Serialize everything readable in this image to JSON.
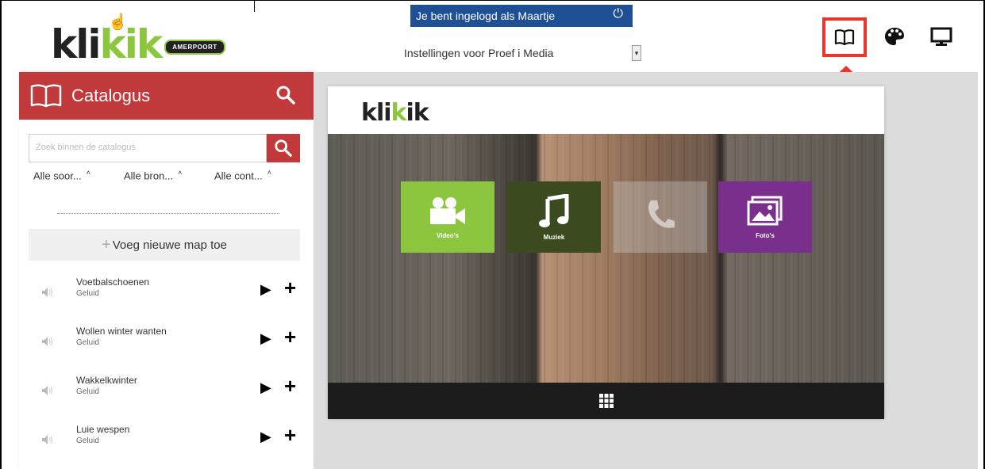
{
  "header": {
    "logo_text_dark": "kli",
    "logo_text_green_k": "k",
    "logo_text_tail": "ik",
    "logo_badge": "AMERPOORT",
    "login_banner": "Je bent ingelogd als Maartje",
    "settings_label": "Instellingen voor",
    "settings_value": "Proef i Media",
    "icons": [
      "book-icon",
      "palette-icon",
      "monitor-icon"
    ],
    "highlight_color": "#e8372a"
  },
  "sidebar": {
    "title": "Catalogus",
    "accent_color": "#c1393b",
    "search_placeholder": "Zoek binnen de catalogus",
    "filters": [
      "Alle soor...",
      "Alle bron...",
      "Alle cont..."
    ],
    "add_folder_label": "Voeg nieuwe map toe",
    "items": [
      {
        "name": "Voetbalschoenen",
        "kind": "Geluid"
      },
      {
        "name": "Wollen winter wanten",
        "kind": "Geluid"
      },
      {
        "name": "Wakkelkwinter",
        "kind": "Geluid"
      },
      {
        "name": "Luie wespen",
        "kind": "Geluid"
      }
    ]
  },
  "preview": {
    "logo_dark": "kli",
    "logo_green": "k",
    "logo_tail": "ik",
    "tiles": [
      {
        "label": "Video's",
        "color": "#8cc63f",
        "icon": "video-camera-icon"
      },
      {
        "label": "Muziek",
        "color": "#3b4a1f",
        "icon": "music-note-icon"
      },
      {
        "label": "",
        "color": "#c9c9c9",
        "icon": "phone-icon"
      },
      {
        "label": "Foto's",
        "color": "#7a2f8c",
        "icon": "pictures-icon"
      }
    ],
    "bottom_icon": "grid-icon"
  }
}
